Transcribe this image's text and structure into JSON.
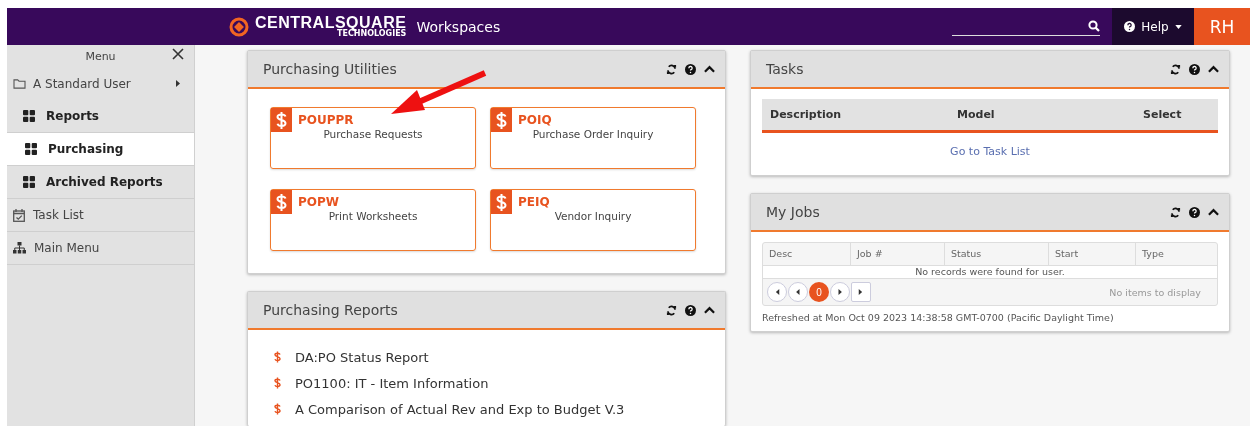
{
  "header": {
    "brand": "CENTRALSQUARE",
    "brand_sub": "TECHNOLOGIES",
    "app": "Workspaces",
    "help": "Help",
    "avatar": "RH"
  },
  "sidebar": {
    "title": "Menu",
    "items": [
      {
        "kind": "folder",
        "label": "A Standard User",
        "selected": false
      },
      {
        "kind": "group",
        "label": "Reports",
        "selected": false
      },
      {
        "kind": "group",
        "label": "Purchasing",
        "selected": true
      },
      {
        "kind": "group",
        "label": "Archived Reports",
        "selected": false
      },
      {
        "kind": "tasks",
        "label": "Task List",
        "selected": false
      },
      {
        "kind": "tree",
        "label": "Main Menu",
        "selected": false
      }
    ]
  },
  "left": [
    {
      "kind": "tiles",
      "title": "Purchasing Utilities",
      "tiles": [
        {
          "code": "POUPPR",
          "label": "Purchase Requests"
        },
        {
          "code": "POIQ",
          "label": "Purchase Order Inquiry"
        },
        {
          "code": "POPW",
          "label": "Print Worksheets"
        },
        {
          "code": "PEIQ",
          "label": "Vendor Inquiry"
        }
      ]
    },
    {
      "kind": "reports",
      "title": "Purchasing Reports",
      "reports": [
        "DA:PO Status Report",
        "PO1100: IT - Item Information",
        "A Comparison of Actual Rev and Exp to Budget V.3"
      ]
    }
  ],
  "right": [
    {
      "kind": "tasks",
      "title": "Tasks",
      "columns": [
        "Description",
        "Model",
        "Select"
      ],
      "link": "Go to Task List"
    },
    {
      "kind": "jobs",
      "title": "My Jobs",
      "columns": [
        "Desc",
        "Job #",
        "Status",
        "Start",
        "Type"
      ],
      "empty": "No records were found for user.",
      "pager": {
        "page": "0",
        "info": "No items to display"
      },
      "refreshed": "Refreshed at Mon Oct 09 2023 14:38:58 GMT-0700 (Pacific Daylight Time)"
    }
  ]
}
